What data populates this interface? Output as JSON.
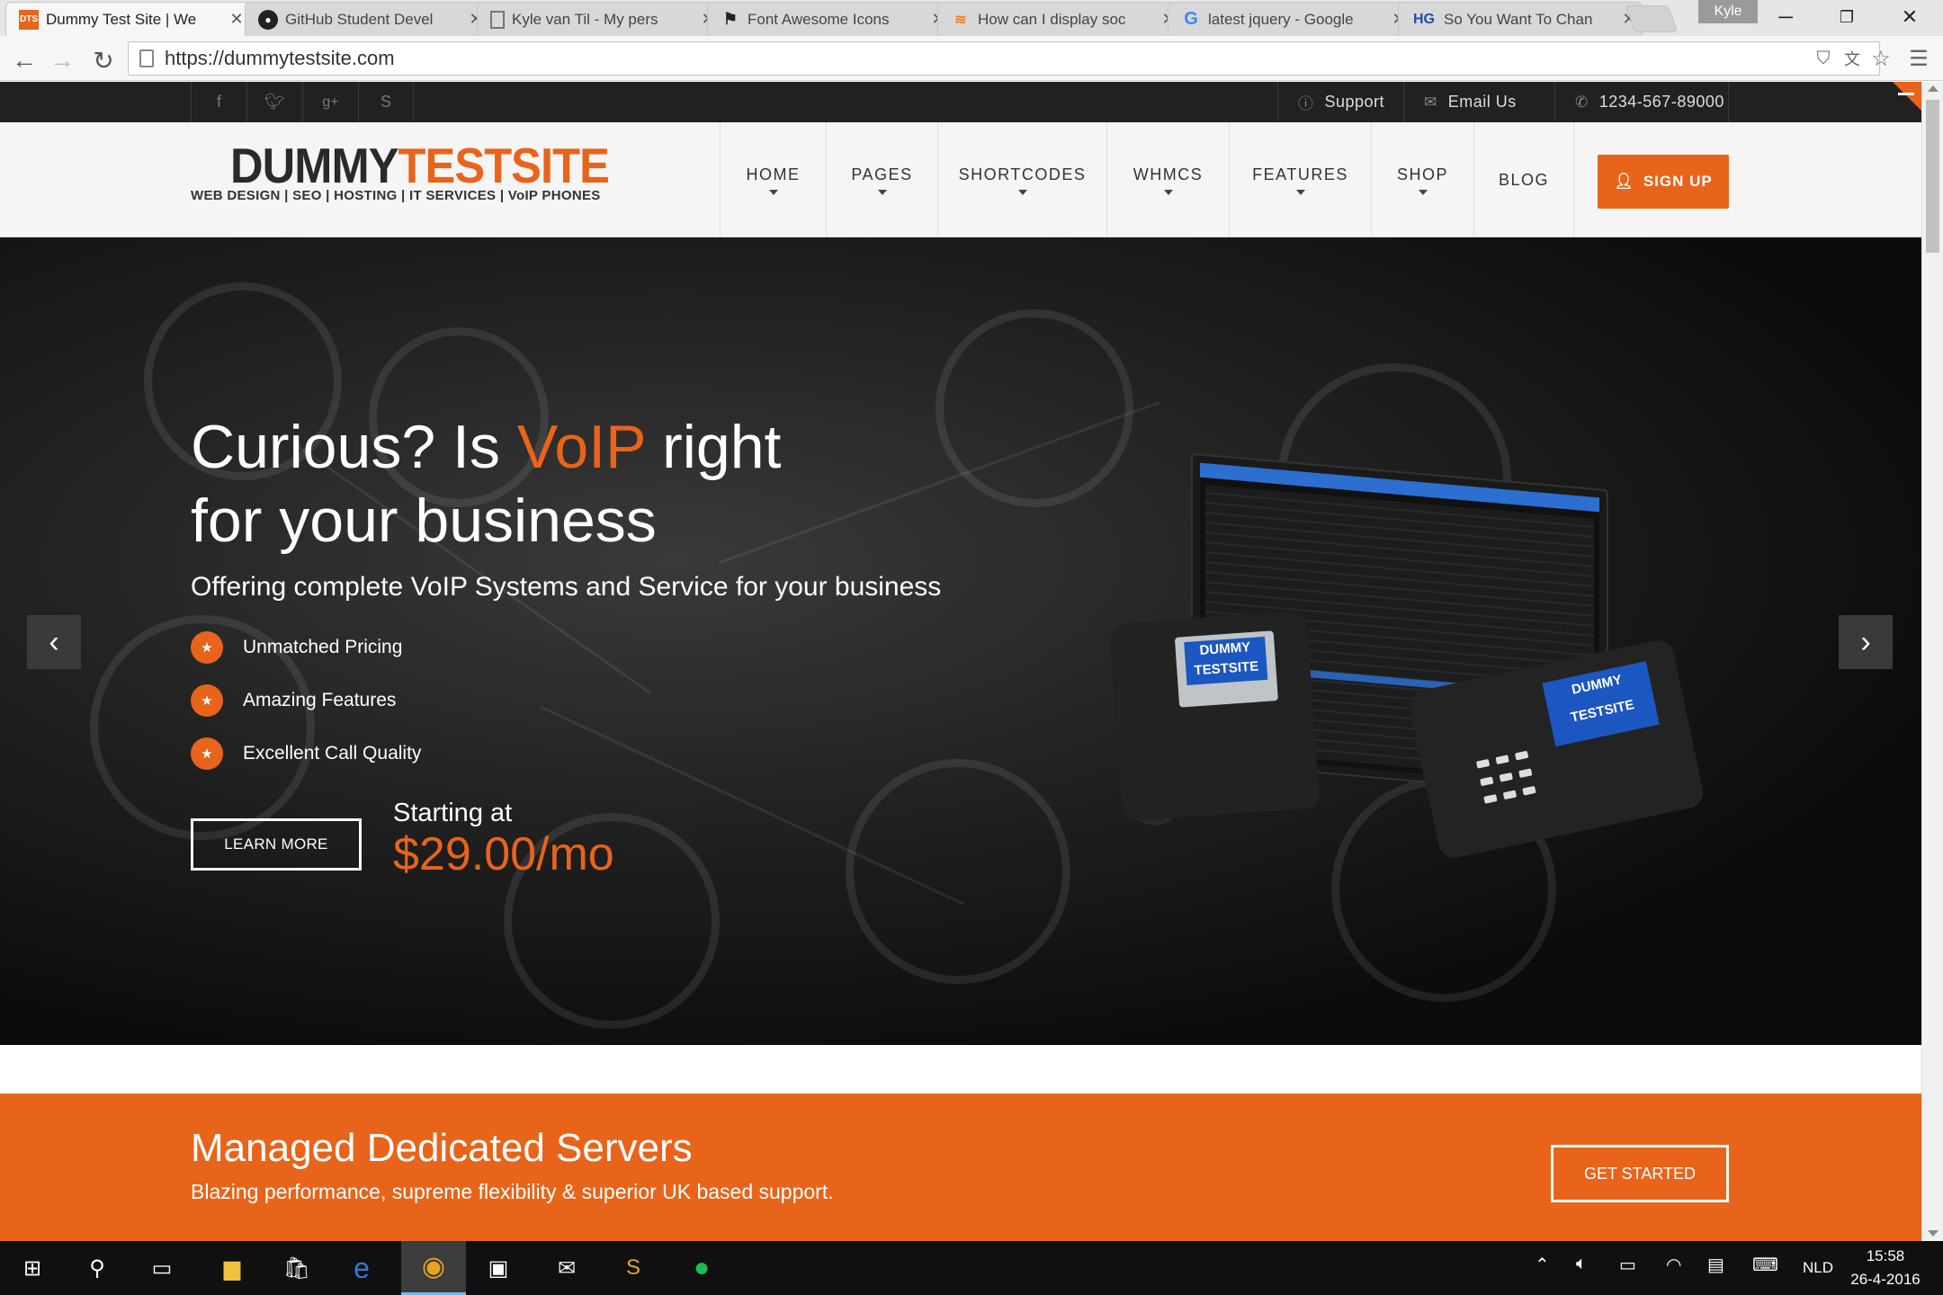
{
  "browser": {
    "tabs": [
      {
        "title": "Dummy Test Site | We",
        "favicon": "dts-icon",
        "active": true
      },
      {
        "title": "GitHub Student Devel",
        "favicon": "github-icon"
      },
      {
        "title": "Kyle van Til - My pers",
        "favicon": "page-icon"
      },
      {
        "title": "Font Awesome Icons",
        "favicon": "flag-icon"
      },
      {
        "title": "How can I display soc",
        "favicon": "stackoverflow-icon"
      },
      {
        "title": "latest jquery - Google",
        "favicon": "google-icon"
      },
      {
        "title": "So You Want To Chan",
        "favicon": "hg-icon"
      }
    ],
    "profile": "Kyle",
    "url": "https://dummytestsite.com"
  },
  "topbar": {
    "support": "Support",
    "email": "Email Us",
    "phone": "1234-567-89000"
  },
  "header": {
    "logo_dummy": "DUMMY",
    "logo_testsite": "TESTSITE",
    "tagline": "WEB DESIGN | SEO | HOSTING | IT SERVICES | VoIP PHONES",
    "nav": [
      "HOME",
      "PAGES",
      "SHORTCODES",
      "WHMCS",
      "FEATURES",
      "SHOP",
      "BLOG"
    ],
    "signup": "SIGN UP"
  },
  "hero": {
    "title_a": "Curious? Is ",
    "title_b": "VoIP",
    "title_c": " right",
    "title_d": "for your business",
    "subtitle": "Offering complete VoIP Systems and Service for your business",
    "features": [
      "Unmatched Pricing",
      "Amazing Features",
      "Excellent Call Quality"
    ],
    "learn_more": "LEARN MORE",
    "starting_at": "Starting at",
    "price": "$29.00/mo",
    "phone1_label": "DUMMY TESTSITE",
    "phone2_label": "DUMMY TESTSITE"
  },
  "band": {
    "title": "Managed Dedicated Servers",
    "subtitle": "Blazing performance, supreme flexibility & superior UK based support.",
    "button": "GET STARTED"
  },
  "taskbar": {
    "language": "NLD",
    "time": "15:58",
    "date": "26-4-2016"
  },
  "colors": {
    "accent": "#e8641a",
    "topbar": "#212121",
    "taskbar": "#101010"
  }
}
